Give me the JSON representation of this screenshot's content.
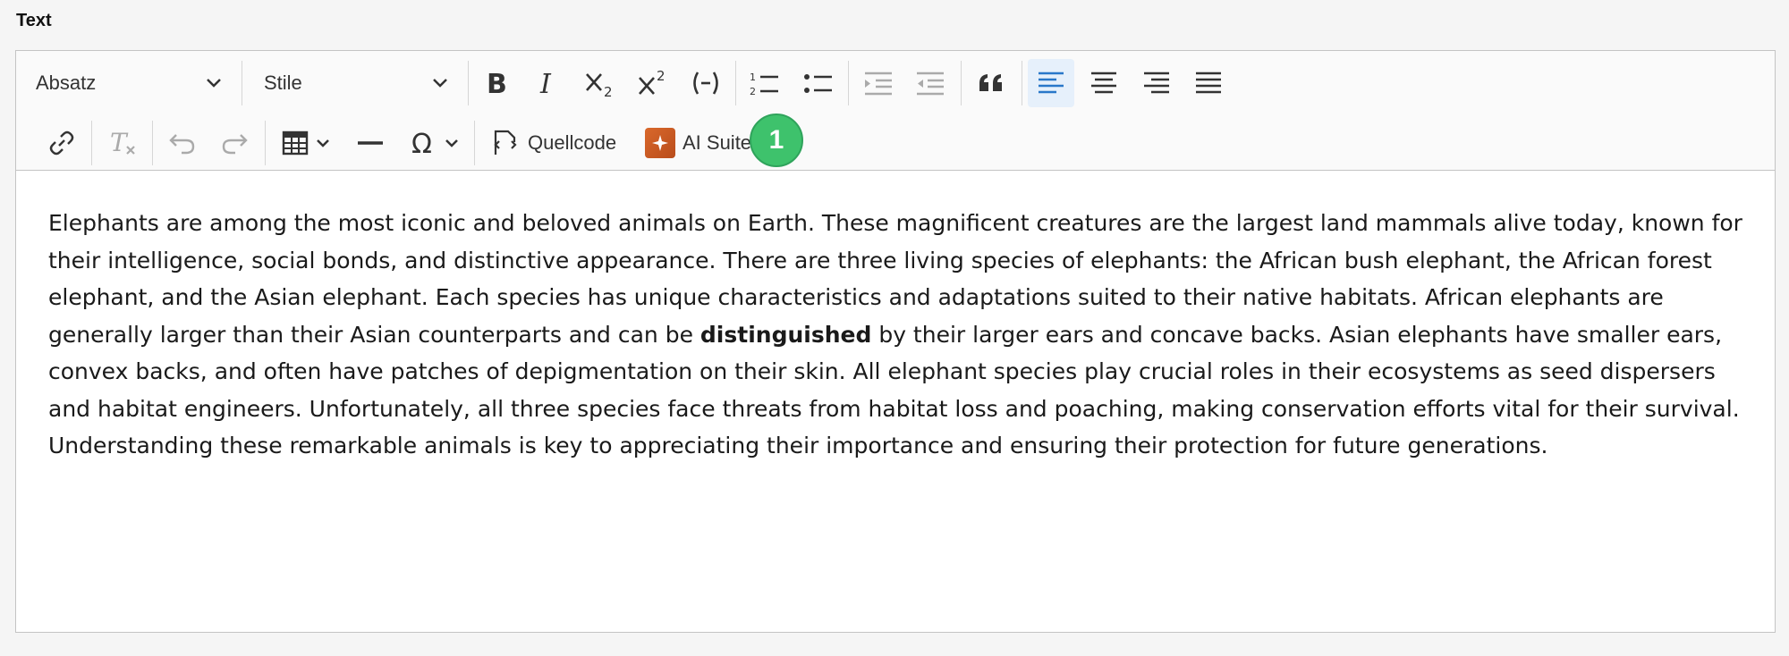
{
  "field_label": "Text",
  "toolbar": {
    "paragraph_select": "Absatz",
    "style_select": "Stile",
    "source_label": "Quellcode",
    "ai_label": "AI Suite",
    "badge": "1",
    "icons": [
      "bold-icon",
      "italic-icon",
      "subscript-icon",
      "superscript-icon",
      "inline-code-icon",
      "numbered-list-icon",
      "bullet-list-icon",
      "outdent-icon",
      "indent-icon",
      "blockquote-icon",
      "align-left-icon",
      "align-center-icon",
      "align-right-icon",
      "justify-icon",
      "link-icon",
      "remove-format-icon",
      "undo-icon",
      "redo-icon",
      "table-icon",
      "horizontal-line-icon",
      "special-characters-icon",
      "source-code-icon",
      "ai-suite-icon"
    ],
    "accent_color": "#2977c9",
    "badge_color": "#3ec26c"
  },
  "content": {
    "before_bold": "Elephants are among the most iconic and beloved animals on Earth. These magnificent creatures are the largest land mammals alive today, known for their intelligence, social bonds, and distinctive appearance. There are three living species of elephants: the African bush elephant, the African forest elephant, and the Asian elephant. Each species has unique characteristics and adaptations suited to their native habitats. African elephants are generally larger than their Asian counterparts and can be ",
    "bold": "distinguished",
    "after_bold": " by their larger ears and concave backs. Asian elephants have smaller ears, convex backs, and often have patches of depigmentation on their skin. All elephant species play crucial roles in their ecosystems as seed dispersers and habitat engineers. Unfortunately, all three species face threats from habitat loss and poaching, making conservation efforts vital for their survival. Understanding these remarkable animals is key to appreciating their importance and ensuring their protection for future generations."
  }
}
